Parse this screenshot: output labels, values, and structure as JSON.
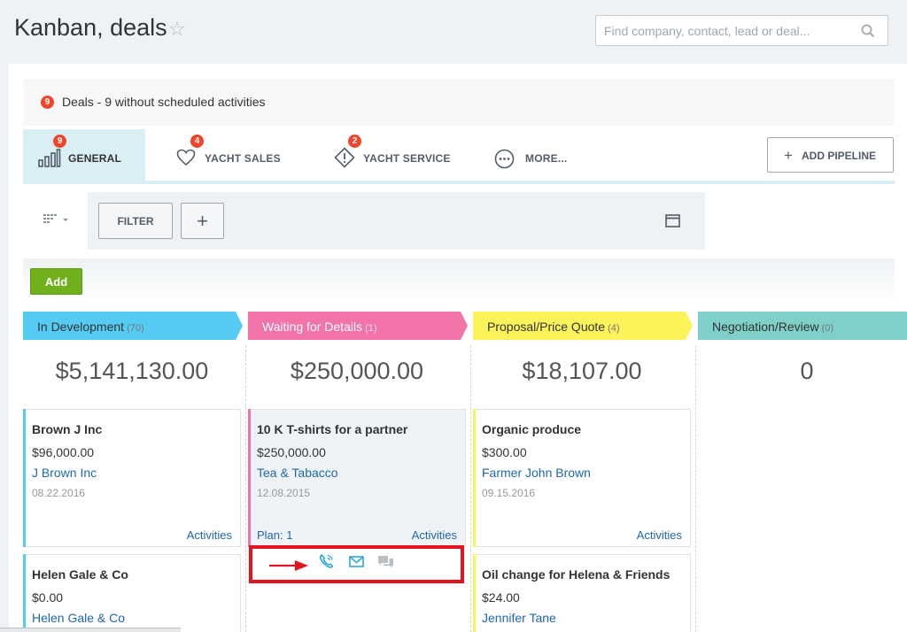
{
  "header": {
    "title": "Kanban, deals",
    "search_placeholder": "Find company, contact, lead or deal..."
  },
  "notice": {
    "badge": "9",
    "text": "Deals - 9 without scheduled activities"
  },
  "tabs": [
    {
      "label": "GENERAL",
      "badge": "9",
      "icon": "bar-chart-icon",
      "active": true
    },
    {
      "label": "YACHT SALES",
      "badge": "4",
      "icon": "heart-icon",
      "active": false
    },
    {
      "label": "YACHT SERVICE",
      "badge": "2",
      "icon": "warning-icon",
      "active": false
    },
    {
      "label": "MORE...",
      "badge": "",
      "icon": "more-icon",
      "active": false
    }
  ],
  "add_pipeline": {
    "label": "ADD PIPELINE"
  },
  "filter": {
    "label": "FILTER",
    "plus": "+"
  },
  "add_button": {
    "label": "Add"
  },
  "columns": [
    {
      "title": "In Development",
      "count": "(70)",
      "total": "$5,141,130.00",
      "color": "#55cbf3"
    },
    {
      "title": "Waiting for Details",
      "count": "(1)",
      "total": "$250,000.00",
      "color": "#f273a9"
    },
    {
      "title": "Proposal/Price Quote",
      "count": "(4)",
      "total": "$18,107.00",
      "color": "#fbf359"
    },
    {
      "title": "Negotiation/Review",
      "count": "(0)",
      "total": "0",
      "color": "#7ed0c8"
    }
  ],
  "cards": {
    "c1": {
      "title": "Brown J Inc",
      "price": "$96,000.00",
      "contact": "J Brown Inc",
      "date": "08.22.2016",
      "activities": "Activities"
    },
    "c2": {
      "title": "Helen Gale & Co",
      "price": "$0.00",
      "contact": "Helen Gale & Co"
    },
    "c3": {
      "title": "10 K T-shirts for a partner",
      "price": "$250,000.00",
      "contact": "Tea & Tabacco",
      "date": "12.08.2015",
      "plan": "Plan: 1",
      "activities": "Activities"
    },
    "c4": {
      "title": "Organic produce",
      "price": "$300.00",
      "contact": "Farmer John Brown",
      "date": "09.15.2016",
      "activities": "Activities"
    },
    "c5": {
      "title": "Oil change for Helena & Friends",
      "price": "$24.00",
      "contact": "Jennifer Tane"
    }
  }
}
